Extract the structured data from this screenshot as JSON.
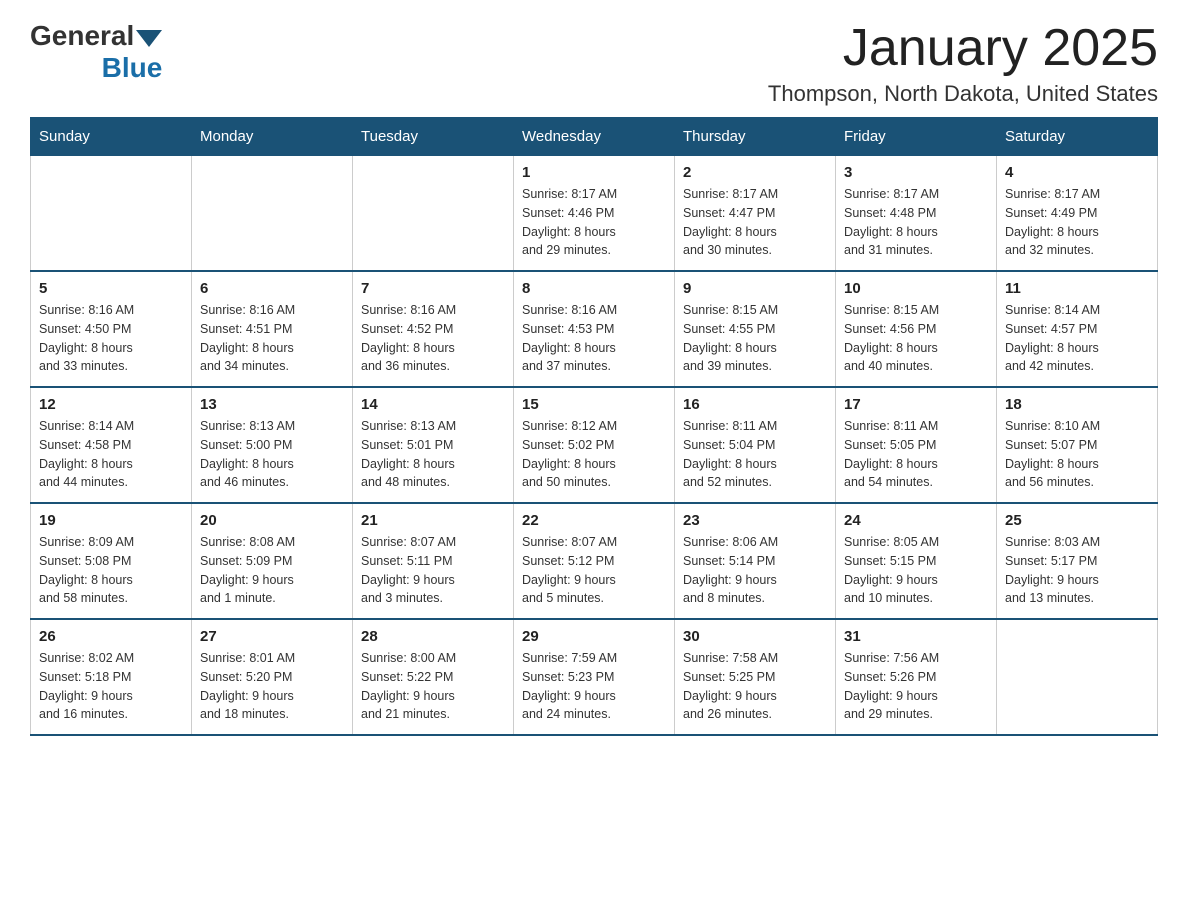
{
  "logo": {
    "general": "General",
    "arrow": "▼",
    "blue": "Blue"
  },
  "title": "January 2025",
  "location": "Thompson, North Dakota, United States",
  "days_of_week": [
    "Sunday",
    "Monday",
    "Tuesday",
    "Wednesday",
    "Thursday",
    "Friday",
    "Saturday"
  ],
  "weeks": [
    [
      {
        "day": "",
        "info": ""
      },
      {
        "day": "",
        "info": ""
      },
      {
        "day": "",
        "info": ""
      },
      {
        "day": "1",
        "info": "Sunrise: 8:17 AM\nSunset: 4:46 PM\nDaylight: 8 hours\nand 29 minutes."
      },
      {
        "day": "2",
        "info": "Sunrise: 8:17 AM\nSunset: 4:47 PM\nDaylight: 8 hours\nand 30 minutes."
      },
      {
        "day": "3",
        "info": "Sunrise: 8:17 AM\nSunset: 4:48 PM\nDaylight: 8 hours\nand 31 minutes."
      },
      {
        "day": "4",
        "info": "Sunrise: 8:17 AM\nSunset: 4:49 PM\nDaylight: 8 hours\nand 32 minutes."
      }
    ],
    [
      {
        "day": "5",
        "info": "Sunrise: 8:16 AM\nSunset: 4:50 PM\nDaylight: 8 hours\nand 33 minutes."
      },
      {
        "day": "6",
        "info": "Sunrise: 8:16 AM\nSunset: 4:51 PM\nDaylight: 8 hours\nand 34 minutes."
      },
      {
        "day": "7",
        "info": "Sunrise: 8:16 AM\nSunset: 4:52 PM\nDaylight: 8 hours\nand 36 minutes."
      },
      {
        "day": "8",
        "info": "Sunrise: 8:16 AM\nSunset: 4:53 PM\nDaylight: 8 hours\nand 37 minutes."
      },
      {
        "day": "9",
        "info": "Sunrise: 8:15 AM\nSunset: 4:55 PM\nDaylight: 8 hours\nand 39 minutes."
      },
      {
        "day": "10",
        "info": "Sunrise: 8:15 AM\nSunset: 4:56 PM\nDaylight: 8 hours\nand 40 minutes."
      },
      {
        "day": "11",
        "info": "Sunrise: 8:14 AM\nSunset: 4:57 PM\nDaylight: 8 hours\nand 42 minutes."
      }
    ],
    [
      {
        "day": "12",
        "info": "Sunrise: 8:14 AM\nSunset: 4:58 PM\nDaylight: 8 hours\nand 44 minutes."
      },
      {
        "day": "13",
        "info": "Sunrise: 8:13 AM\nSunset: 5:00 PM\nDaylight: 8 hours\nand 46 minutes."
      },
      {
        "day": "14",
        "info": "Sunrise: 8:13 AM\nSunset: 5:01 PM\nDaylight: 8 hours\nand 48 minutes."
      },
      {
        "day": "15",
        "info": "Sunrise: 8:12 AM\nSunset: 5:02 PM\nDaylight: 8 hours\nand 50 minutes."
      },
      {
        "day": "16",
        "info": "Sunrise: 8:11 AM\nSunset: 5:04 PM\nDaylight: 8 hours\nand 52 minutes."
      },
      {
        "day": "17",
        "info": "Sunrise: 8:11 AM\nSunset: 5:05 PM\nDaylight: 8 hours\nand 54 minutes."
      },
      {
        "day": "18",
        "info": "Sunrise: 8:10 AM\nSunset: 5:07 PM\nDaylight: 8 hours\nand 56 minutes."
      }
    ],
    [
      {
        "day": "19",
        "info": "Sunrise: 8:09 AM\nSunset: 5:08 PM\nDaylight: 8 hours\nand 58 minutes."
      },
      {
        "day": "20",
        "info": "Sunrise: 8:08 AM\nSunset: 5:09 PM\nDaylight: 9 hours\nand 1 minute."
      },
      {
        "day": "21",
        "info": "Sunrise: 8:07 AM\nSunset: 5:11 PM\nDaylight: 9 hours\nand 3 minutes."
      },
      {
        "day": "22",
        "info": "Sunrise: 8:07 AM\nSunset: 5:12 PM\nDaylight: 9 hours\nand 5 minutes."
      },
      {
        "day": "23",
        "info": "Sunrise: 8:06 AM\nSunset: 5:14 PM\nDaylight: 9 hours\nand 8 minutes."
      },
      {
        "day": "24",
        "info": "Sunrise: 8:05 AM\nSunset: 5:15 PM\nDaylight: 9 hours\nand 10 minutes."
      },
      {
        "day": "25",
        "info": "Sunrise: 8:03 AM\nSunset: 5:17 PM\nDaylight: 9 hours\nand 13 minutes."
      }
    ],
    [
      {
        "day": "26",
        "info": "Sunrise: 8:02 AM\nSunset: 5:18 PM\nDaylight: 9 hours\nand 16 minutes."
      },
      {
        "day": "27",
        "info": "Sunrise: 8:01 AM\nSunset: 5:20 PM\nDaylight: 9 hours\nand 18 minutes."
      },
      {
        "day": "28",
        "info": "Sunrise: 8:00 AM\nSunset: 5:22 PM\nDaylight: 9 hours\nand 21 minutes."
      },
      {
        "day": "29",
        "info": "Sunrise: 7:59 AM\nSunset: 5:23 PM\nDaylight: 9 hours\nand 24 minutes."
      },
      {
        "day": "30",
        "info": "Sunrise: 7:58 AM\nSunset: 5:25 PM\nDaylight: 9 hours\nand 26 minutes."
      },
      {
        "day": "31",
        "info": "Sunrise: 7:56 AM\nSunset: 5:26 PM\nDaylight: 9 hours\nand 29 minutes."
      },
      {
        "day": "",
        "info": ""
      }
    ]
  ]
}
